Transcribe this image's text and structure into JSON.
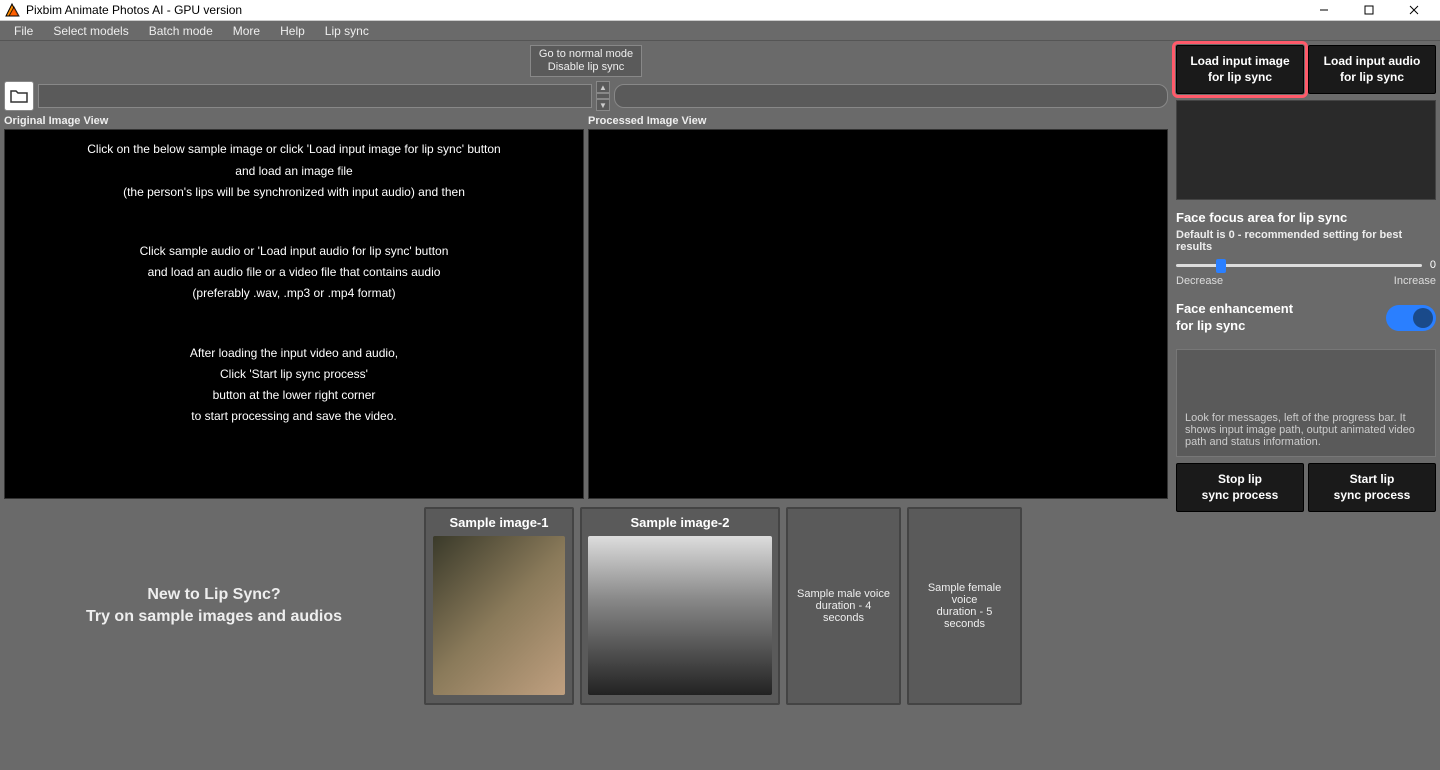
{
  "titlebar": {
    "title": "Pixbim Animate Photos AI - GPU version"
  },
  "menubar": [
    "File",
    "Select models",
    "Batch mode",
    "More",
    "Help",
    "Lip sync"
  ],
  "mode_button": {
    "line1": "Go to normal mode",
    "line2": "Disable lip sync"
  },
  "views": {
    "original_label": "Original Image View",
    "processed_label": "Processed Image View",
    "instructions": [
      "Click on the below sample image or click 'Load input image for lip sync' button",
      "and load an image file",
      "(the person's lips will be synchronized with input audio) and then",
      "",
      "",
      "Click sample audio or 'Load input audio for lip sync' button",
      "and load an audio file or a video file that contains audio",
      "(preferably .wav, .mp3 or .mp4 format)",
      "",
      "",
      "After loading the input video and audio,",
      "Click 'Start lip sync process'",
      "button at the lower right corner",
      "to start processing and save the video."
    ]
  },
  "samples": {
    "intro_line1": "New to Lip Sync?",
    "intro_line2": "Try on sample images and audios",
    "card1_title": "Sample image-1",
    "card2_title": "Sample image-2",
    "card3_line1": "Sample male voice",
    "card3_line2": "duration - 4 seconds",
    "card4_line1": "Sample female voice",
    "card4_line2": "duration - 5 seconds"
  },
  "right": {
    "load_image_line1": "Load input image",
    "load_image_line2": "for lip sync",
    "load_audio_line1": "Load input audio",
    "load_audio_line2": "for lip sync",
    "focus_title": "Face focus area for lip sync",
    "focus_sub": "Default is 0 - recommended setting for best results",
    "slider_value": "0",
    "slider_left": "Decrease",
    "slider_right": "Increase",
    "enhance_line1": "Face enhancement",
    "enhance_line2": "for lip sync",
    "msg_hint": "Look for messages, left of the progress bar. It shows input image path, output animated video path and status information.",
    "stop_line1": "Stop lip",
    "stop_line2": "sync process",
    "start_line1": "Start lip",
    "start_line2": "sync process"
  }
}
